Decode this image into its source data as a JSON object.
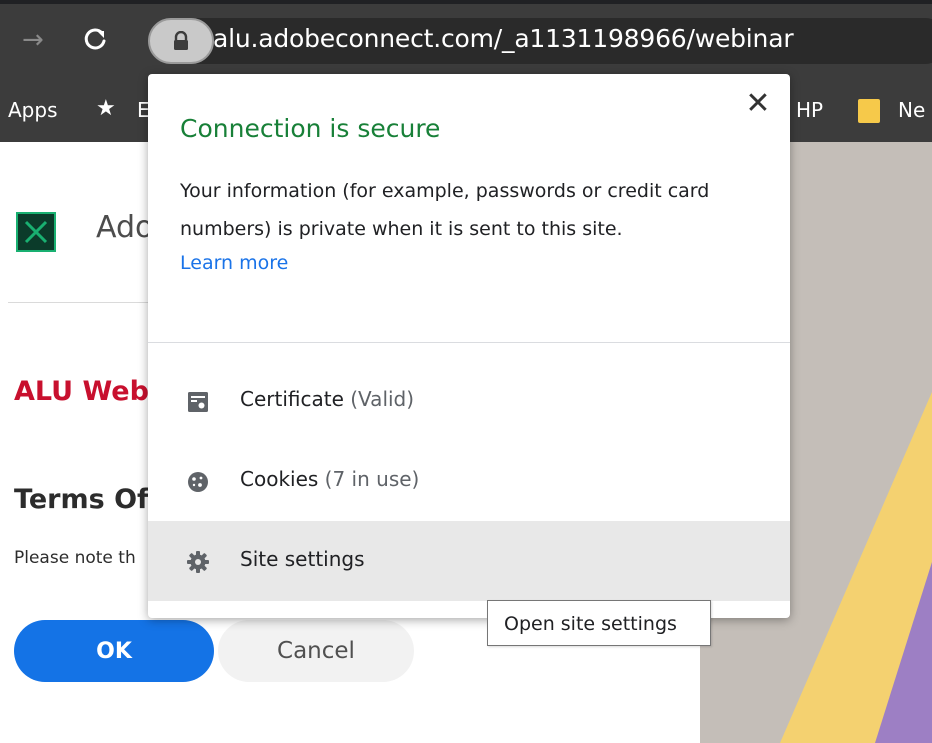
{
  "browser": {
    "url": "alu.adobeconnect.com/_a1131198966/webinar",
    "bookmarks": {
      "apps": "Apps",
      "first_partial": "E",
      "hp_partial": "HP",
      "ne_partial": "Ne"
    },
    "icons": {
      "forward": "arrow-forward-icon",
      "reload": "reload-icon",
      "lock": "lock-icon",
      "star": "star-icon",
      "folder": "folder-icon"
    }
  },
  "page": {
    "brand_text": "Ado",
    "heading": "ALU Web",
    "terms_heading": "Terms Of",
    "note": "Please note th",
    "ok_label": "OK",
    "cancel_label": "Cancel",
    "colors": {
      "heading_red": "#c8102e",
      "primary_blue": "#1473e6"
    }
  },
  "popup": {
    "title": "Connection is secure",
    "description": "Your information (for example, passwords or credit card numbers) is private when it is sent to this site.",
    "learn_more": "Learn more",
    "close": "✕",
    "rows": [
      {
        "label": "Certificate",
        "sub": "(Valid)",
        "icon": "certificate-icon"
      },
      {
        "label": "Cookies",
        "sub": "(7 in use)",
        "icon": "cookie-icon"
      },
      {
        "label": "Site settings",
        "sub": "",
        "icon": "gear-icon"
      }
    ],
    "colors": {
      "title_green": "#188038",
      "link_blue": "#1a73e8"
    }
  },
  "tooltip": {
    "text": "Open site settings"
  }
}
